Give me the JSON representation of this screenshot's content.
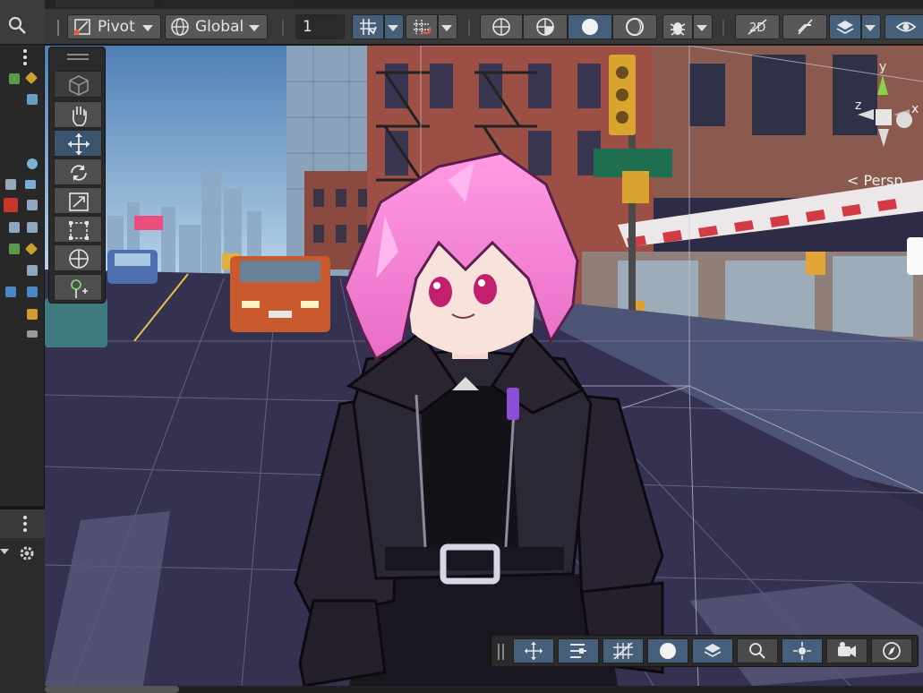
{
  "toolbar": {
    "pivot_label": "Pivot",
    "global_label": "Global",
    "grid_size_value": "1"
  },
  "scene": {
    "projection_label": "Persp",
    "gizmo_axes": {
      "y": "y",
      "x": "x",
      "z": "z"
    }
  },
  "left_panel": {
    "icons": [
      "search-icon",
      "more-vert-icon",
      "script-icon",
      "prefab-icon",
      "cube-icon",
      "puzzle-icon",
      "camera-icon",
      "text-icon",
      "grid-icon",
      "audio-icon",
      "settings-icon"
    ]
  },
  "icons": {
    "pivot": "pivot-icon",
    "global": "globe-icon",
    "grid_snap": "grid-snap-icon",
    "increment_snap": "increment-snap-icon",
    "wireframe": "wireframe-globe-icon",
    "shaded_wireframe": "shaded-wireframe-icon",
    "shaded": "shaded-sphere-icon",
    "unlit": "unlit-sphere-icon",
    "debug": "bug-icon",
    "2d": "2d-toggle-icon",
    "audio_mute": "audio-mute-icon",
    "effects": "layers-icon",
    "visibility": "eye-icon"
  },
  "colors": {
    "active_blue": "#46607c",
    "hair_pink": "#f37ad0",
    "jacket": "#1f1b25",
    "sky_top": "#4f7fb5"
  }
}
